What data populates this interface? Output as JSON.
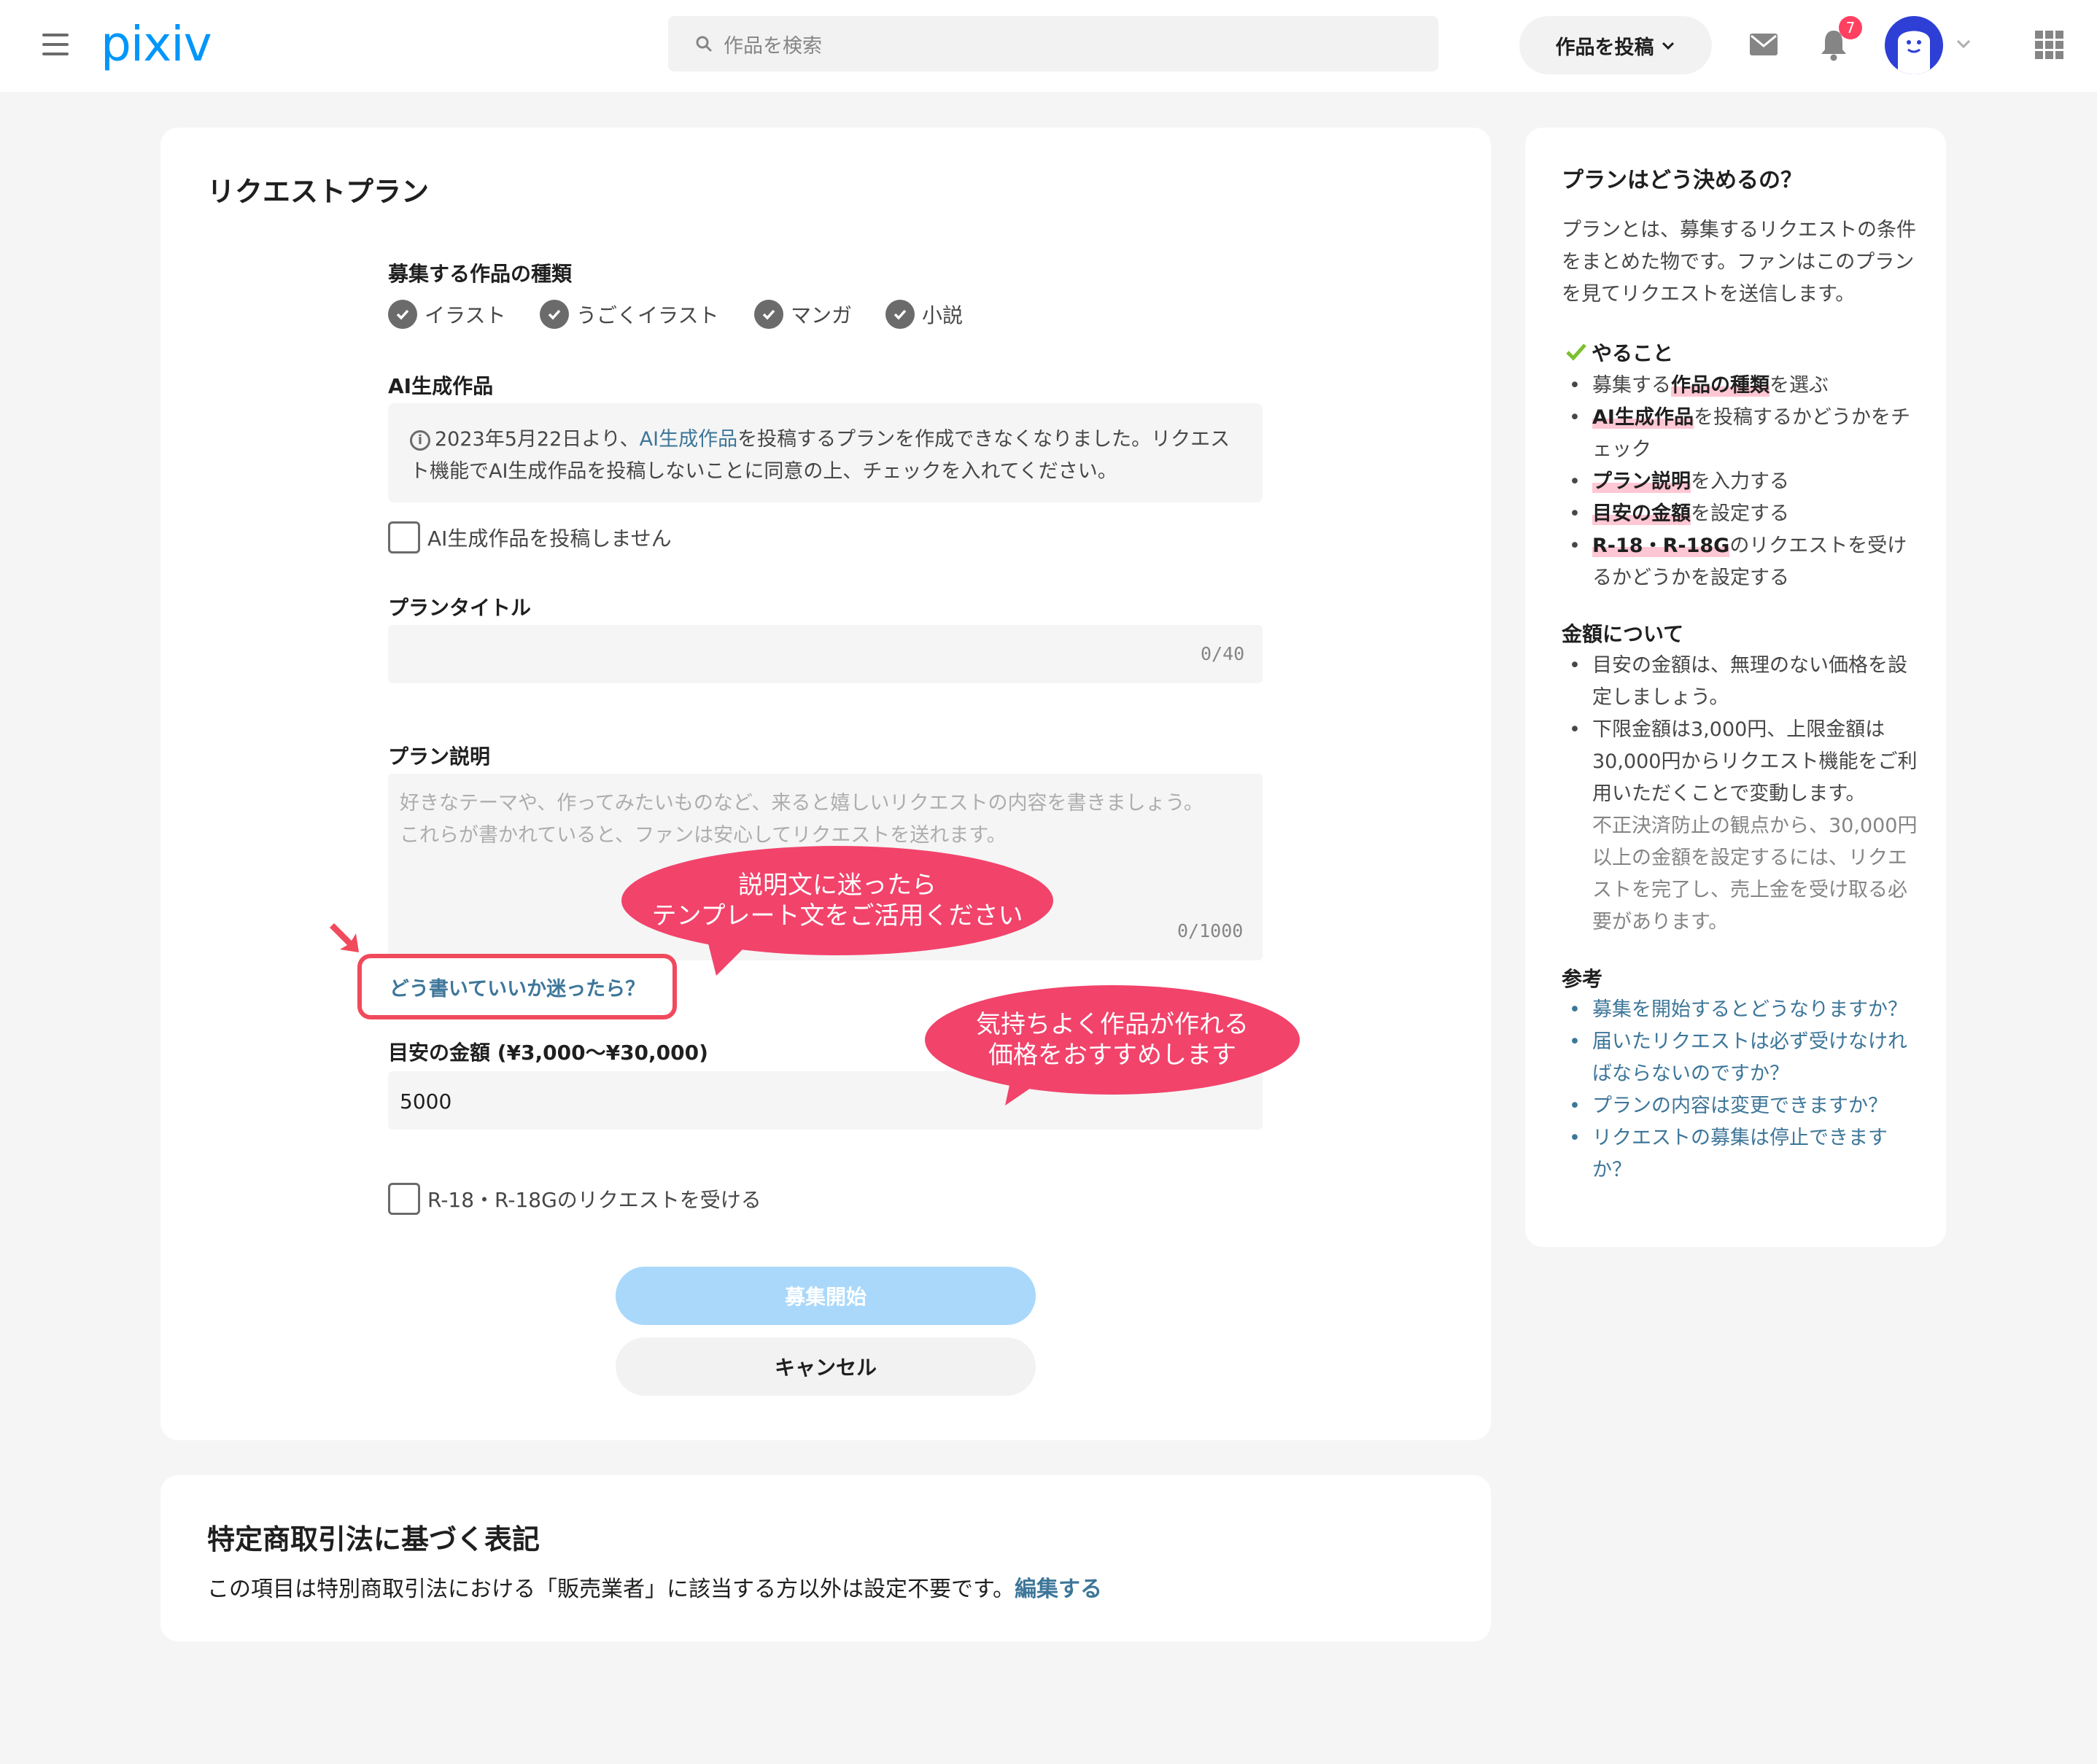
{
  "header": {
    "logo": "pixiv",
    "search_placeholder": "作品を検索",
    "post_button": "作品を投稿",
    "notification_count": "7"
  },
  "main": {
    "title": "リクエストプラン",
    "work_types": {
      "label": "募集する作品の種類",
      "options": [
        "イラスト",
        "うごくイラスト",
        "マンガ",
        "小説"
      ]
    },
    "ai": {
      "label": "AI生成作品",
      "notice_prefix": "2023年5月22日より、",
      "notice_link": "AI生成作品",
      "notice_suffix": "を投稿するプランを作成できなくなりました。リクエスト機能でAI生成作品を投稿しないことに同意の上、チェックを入れてください。",
      "checkbox_label": "AI生成作品を投稿しません"
    },
    "plan_title": {
      "label": "プランタイトル",
      "counter": "0/40"
    },
    "plan_desc": {
      "label": "プラン説明",
      "placeholder_line1": "好きなテーマや、作ってみたいものなど、来ると嬉しいリクエストの内容を書きましょう。",
      "placeholder_line2": "これらが書かれていると、ファンは安心してリクエストを送れます。",
      "counter": "0/1000",
      "howto_link": "どう書いていいか迷ったら？"
    },
    "price": {
      "label": "目安の金額 (¥3,000〜¥30,000)",
      "value": "5000"
    },
    "r18_label": "R-18・R-18Gのリクエストを受ける",
    "start_button": "募集開始",
    "cancel_button": "キャンセル"
  },
  "annotations": {
    "bubble1_line1": "説明文に迷ったら",
    "bubble1_line2": "テンプレート文をご活用ください",
    "bubble2_line1": "気持ちよく作品が作れる",
    "bubble2_line2": "価格をおすすめします"
  },
  "legal": {
    "title": "特定商取引法に基づく表記",
    "text": "この項目は特別商取引法における「販売業者」に該当する方以外は設定不要です。",
    "edit_link": "編集する"
  },
  "side": {
    "title": "プランはどう決めるの？",
    "intro": "プランとは、募集するリクエストの条件をまとめた物です。ファンはこのプランを見てリクエストを送信します。",
    "todo_heading": "やること",
    "todo": [
      {
        "pre": "募集する",
        "hl": "作品の種類",
        "post": "を選ぶ"
      },
      {
        "pre": "",
        "hl": "AI生成作品",
        "post": "を投稿するかどうかをチェック"
      },
      {
        "pre": "",
        "hl": "プラン説明",
        "post": "を入力する"
      },
      {
        "pre": "",
        "hl": "目安の金額",
        "post": "を設定する"
      },
      {
        "pre": "",
        "hl": "R-18・R-18G",
        "post": "のリクエストを受けるかどうかを設定する"
      }
    ],
    "price_heading": "金額について",
    "price_items": [
      "目安の金額は、無理のない価格を設定しましょう。",
      "下限金額は3,000円、上限金額は30,000円からリクエスト機能をご利用いただくことで変動します。"
    ],
    "price_note": "不正決済防止の観点から、30,000円以上の金額を設定するには、リクエストを完了し、売上金を受け取る必要があります。",
    "ref_heading": "参考",
    "ref_links": [
      "募集を開始するとどうなりますか？",
      "届いたリクエストは必ず受けなければならないのですか？",
      "プランの内容は変更できますか？",
      "リクエストの募集は停止できますか？"
    ]
  }
}
